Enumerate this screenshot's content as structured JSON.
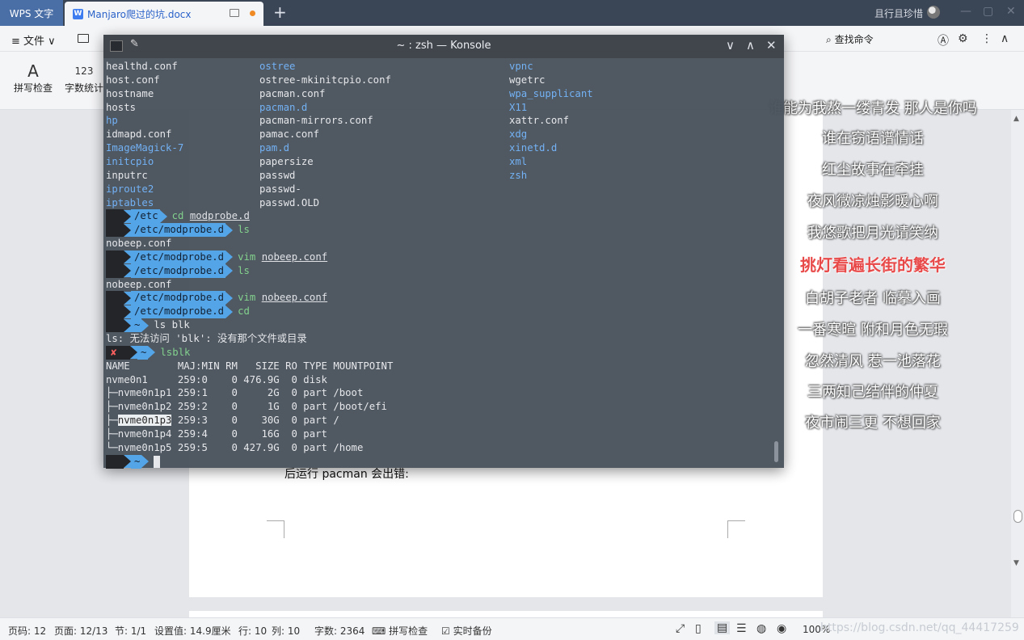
{
  "wps": {
    "home_tab": "WPS 文字",
    "doc_tab": "Manjaro爬过的坑.docx",
    "new_tab": "+",
    "user_name": "且行且珍惜",
    "win_min": "—",
    "win_max": "▢",
    "win_close": "✕",
    "file_menu": "≡ 文件 ∨",
    "search_command": "查找命令",
    "ribbon": {
      "spellcheck": "拼写检查",
      "wordcount": "字数统计"
    },
    "doc_text": "后运行 pacman 会出错:"
  },
  "lyrics": [
    {
      "text": "谁能为我熬一缕青发 那人是你吗",
      "active": false
    },
    {
      "text": "谁在窃语谱情话",
      "active": false
    },
    {
      "text": "红尘故事在牵挂",
      "active": false
    },
    {
      "text": "夜风微凉烛影暖心啊",
      "active": false
    },
    {
      "text": "我悠歌把月光请笑纳",
      "active": false
    },
    {
      "text": "挑灯看遍长街的繁华",
      "active": true
    },
    {
      "text": "白胡子老者 临摹入画",
      "active": false
    },
    {
      "text": "一番寒暄 附和月色无瑕",
      "active": false
    },
    {
      "text": "忽然清风 惹一池落花",
      "active": false
    },
    {
      "text": "三两知己结伴的仲夏",
      "active": false
    },
    {
      "text": "夜市闹三更 不想回家",
      "active": false
    }
  ],
  "konsole": {
    "title": "~ : zsh — Konsole",
    "btn_min": "∨",
    "btn_max": "∧",
    "btn_close": "✕",
    "listing": [
      [
        {
          "t": "healthd.conf",
          "k": "plain"
        },
        {
          "t": "ostree",
          "k": "dir"
        },
        {
          "t": "vpnc",
          "k": "dir"
        }
      ],
      [
        {
          "t": "host.conf",
          "k": "plain"
        },
        {
          "t": "ostree-mkinitcpio.conf",
          "k": "plain"
        },
        {
          "t": "wgetrc",
          "k": "plain"
        }
      ],
      [
        {
          "t": "hostname",
          "k": "plain"
        },
        {
          "t": "pacman.conf",
          "k": "plain"
        },
        {
          "t": "wpa_supplicant",
          "k": "dir"
        }
      ],
      [
        {
          "t": "hosts",
          "k": "plain"
        },
        {
          "t": "pacman.d",
          "k": "dir"
        },
        {
          "t": "X11",
          "k": "dir"
        }
      ],
      [
        {
          "t": "hp",
          "k": "dir"
        },
        {
          "t": "pacman-mirrors.conf",
          "k": "plain"
        },
        {
          "t": "xattr.conf",
          "k": "plain"
        }
      ],
      [
        {
          "t": "idmapd.conf",
          "k": "plain"
        },
        {
          "t": "pamac.conf",
          "k": "plain"
        },
        {
          "t": "xdg",
          "k": "dir"
        }
      ],
      [
        {
          "t": "ImageMagick-7",
          "k": "dir"
        },
        {
          "t": "pam.d",
          "k": "dir"
        },
        {
          "t": "xinetd.d",
          "k": "dir"
        }
      ],
      [
        {
          "t": "initcpio",
          "k": "dir"
        },
        {
          "t": "papersize",
          "k": "plain"
        },
        {
          "t": "xml",
          "k": "dir"
        }
      ],
      [
        {
          "t": "inputrc",
          "k": "plain"
        },
        {
          "t": "passwd",
          "k": "plain"
        },
        {
          "t": "zsh",
          "k": "dir"
        }
      ],
      [
        {
          "t": "iproute2",
          "k": "dir"
        },
        {
          "t": "passwd-",
          "k": "plain"
        },
        {
          "t": "",
          "k": "plain"
        }
      ],
      [
        {
          "t": "iptables",
          "k": "dir"
        },
        {
          "t": "passwd.OLD",
          "k": "plain"
        },
        {
          "t": "",
          "k": "plain"
        }
      ]
    ],
    "session": [
      {
        "type": "prompt",
        "dir": "/etc",
        "cmd": "cd",
        "arg": "modprobe.d"
      },
      {
        "type": "prompt",
        "dir": "/etc/modprobe.d",
        "cmd": "ls",
        "arg": ""
      },
      {
        "type": "out",
        "text": "nobeep.conf"
      },
      {
        "type": "prompt",
        "dir": "/etc/modprobe.d",
        "cmd": "vim",
        "arg": "nobeep.conf"
      },
      {
        "type": "prompt",
        "dir": "/etc/modprobe.d",
        "cmd": "ls",
        "arg": ""
      },
      {
        "type": "out",
        "text": "nobeep.conf"
      },
      {
        "type": "prompt",
        "dir": "/etc/modprobe.d",
        "cmd": "vim",
        "arg": "nobeep.conf"
      },
      {
        "type": "prompt",
        "dir": "/etc/modprobe.d",
        "cmd": "cd",
        "arg": ""
      },
      {
        "type": "prompt",
        "dir": "~",
        "cmd": "ls blk",
        "arg": "",
        "plaincmd": true
      },
      {
        "type": "out",
        "text": "ls: 无法访问 'blk': 没有那个文件或目录"
      },
      {
        "type": "prompt_err",
        "dir": "~",
        "cmd": "lsblk",
        "arg": "",
        "mark": "✘"
      },
      {
        "type": "out",
        "text": "NAME        MAJ:MIN RM   SIZE RO TYPE MOUNTPOINT"
      },
      {
        "type": "out",
        "text": "nvme0n1     259:0    0 476.9G  0 disk "
      },
      {
        "type": "out",
        "text": "├─nvme0n1p1 259:1    0     2G  0 part /boot"
      },
      {
        "type": "out",
        "text": "├─nvme0n1p2 259:2    0     1G  0 part /boot/efi"
      },
      {
        "type": "out_sel",
        "pre": "├─",
        "sel": "nvme0n1p3",
        "post": " 259:3    0    30G  0 part /"
      },
      {
        "type": "out",
        "text": "├─nvme0n1p4 259:4    0    16G  0 part "
      },
      {
        "type": "out",
        "text": "└─nvme0n1p5 259:5    0 427.9G  0 part /home"
      },
      {
        "type": "prompt_cursor",
        "dir": "~"
      }
    ]
  },
  "status": {
    "page_code": "页码: 12",
    "page": "页面: 12/13",
    "section": "节: 1/1",
    "setting": "设置值: 14.9厘米",
    "row": "行: 10",
    "col": "列: 10",
    "words": "字数: 2364",
    "spell": "拼写检查",
    "backup": "实时备份",
    "zoom": "100%",
    "watermark": "https://blog.csdn.net/qq_44417259"
  }
}
